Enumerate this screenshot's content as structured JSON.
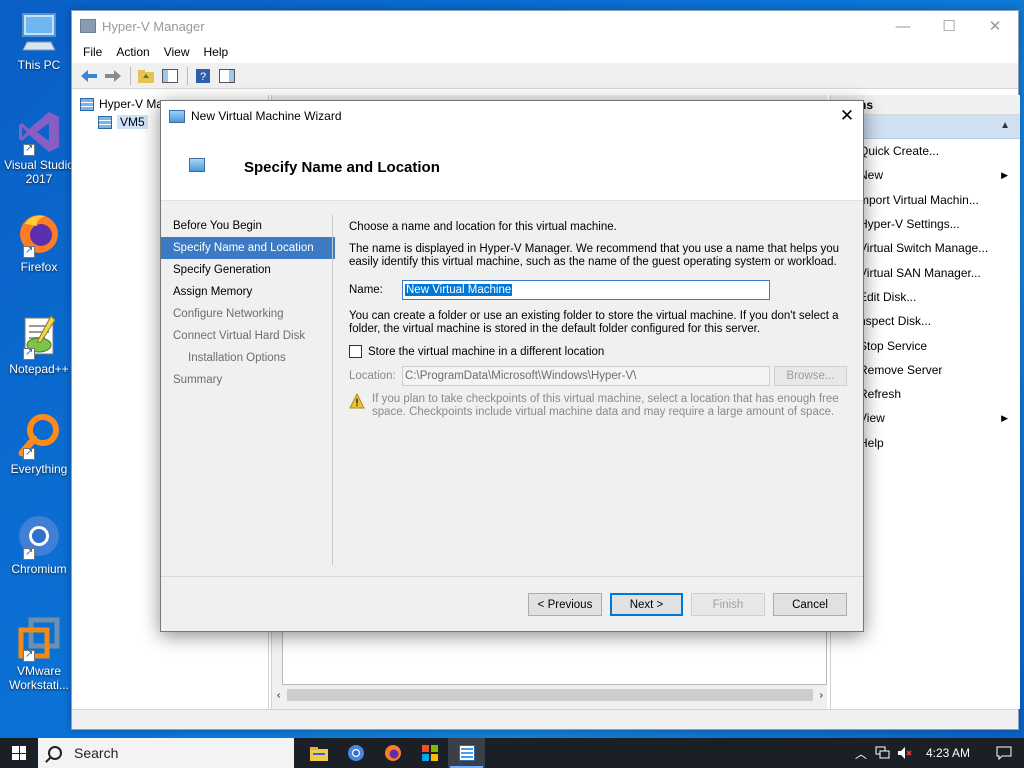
{
  "desktop": {
    "icons": [
      {
        "label_line1": "This PC",
        "label_line2": ""
      },
      {
        "label_line1": "Visual Studio",
        "label_line2": "2017"
      },
      {
        "label_line1": "Firefox",
        "label_line2": ""
      },
      {
        "label_line1": "Notepad++",
        "label_line2": ""
      },
      {
        "label_line1": "Everything",
        "label_line2": ""
      },
      {
        "label_line1": "Chromium",
        "label_line2": ""
      },
      {
        "label_line1": "VMware",
        "label_line2": "Workstati..."
      }
    ]
  },
  "mmc": {
    "title": "Hyper-V Manager",
    "controls": {
      "minimize": "—",
      "maximize": "☐",
      "close": "✕"
    },
    "menu": [
      "File",
      "Action",
      "View",
      "Help"
    ],
    "tree": {
      "root": "Hyper-V Ma",
      "child": "VM5"
    },
    "actions": {
      "header": "ns",
      "items": [
        {
          "label": "Quick Create...",
          "submenu": false
        },
        {
          "label": "New",
          "submenu": true
        },
        {
          "label": "mport Virtual Machin...",
          "submenu": false
        },
        {
          "label": "Hyper-V Settings...",
          "submenu": false
        },
        {
          "label": "Virtual Switch Manage...",
          "submenu": false
        },
        {
          "label": "Virtual SAN Manager...",
          "submenu": false
        },
        {
          "label": "Edit Disk...",
          "submenu": false
        },
        {
          "label": "nspect Disk...",
          "submenu": false
        },
        {
          "label": "Stop Service",
          "submenu": false
        },
        {
          "label": "Remove Server",
          "submenu": false
        },
        {
          "label": "Refresh",
          "submenu": false
        },
        {
          "label": "View",
          "submenu": true
        },
        {
          "label": "Help",
          "submenu": false
        }
      ]
    }
  },
  "wizard": {
    "title": "New Virtual Machine Wizard",
    "close": "✕",
    "heading": "Specify Name and Location",
    "steps": [
      {
        "label": "Before You Begin",
        "state": "normal",
        "sub": false
      },
      {
        "label": "Specify Name and Location",
        "state": "active",
        "sub": false
      },
      {
        "label": "Specify Generation",
        "state": "normal",
        "sub": false
      },
      {
        "label": "Assign Memory",
        "state": "normal",
        "sub": false
      },
      {
        "label": "Configure Networking",
        "state": "disabled",
        "sub": false
      },
      {
        "label": "Connect Virtual Hard Disk",
        "state": "disabled",
        "sub": false
      },
      {
        "label": "Installation Options",
        "state": "disabled",
        "sub": true
      },
      {
        "label": "Summary",
        "state": "disabled",
        "sub": false
      }
    ],
    "intro": "Choose a name and location for this virtual machine.",
    "desc": "The name is displayed in Hyper-V Manager. We recommend that you use a name that helps you easily identify this virtual machine, such as the name of the guest operating system or workload.",
    "name_label": "Name:",
    "name_value": "New Virtual Machine",
    "folder_desc": "You can create a folder or use an existing folder to store the virtual machine. If you don't select a folder, the virtual machine is stored in the default folder configured for this server.",
    "store_checkbox_label": "Store the virtual machine in a different location",
    "store_checked": false,
    "location_label": "Location:",
    "location_value": "C:\\ProgramData\\Microsoft\\Windows\\Hyper-V\\",
    "browse_label": "Browse...",
    "warning": "If you plan to take checkpoints of this virtual machine, select a location that has enough free space. Checkpoints include virtual machine data and may require a large amount of space.",
    "buttons": {
      "previous": "< Previous",
      "next": "Next >",
      "finish": "Finish",
      "cancel": "Cancel"
    }
  },
  "taskbar": {
    "search_label": "Search",
    "time": "4:23 AM"
  },
  "colors": {
    "selection": "#3c7bc4",
    "desktop": "#0b73d6",
    "taskbar": "#1b1f26"
  }
}
